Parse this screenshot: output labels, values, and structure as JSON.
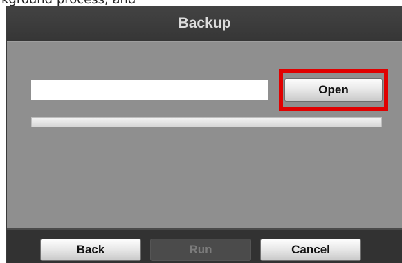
{
  "caption_fragment": "kground process, and",
  "dialog": {
    "title": "Backup",
    "path_input": {
      "value": "",
      "placeholder": ""
    },
    "open_button_label": "Open",
    "progress": {
      "value_percent": 0
    },
    "highlight_color": "#e00000"
  },
  "footer": {
    "back_label": "Back",
    "run_label": "Run",
    "cancel_label": "Cancel"
  },
  "colors": {
    "dialog_body": "#8f8f8f",
    "titlebar": "#3c3c3c",
    "footer": "#323232",
    "highlight": "#e00000"
  }
}
